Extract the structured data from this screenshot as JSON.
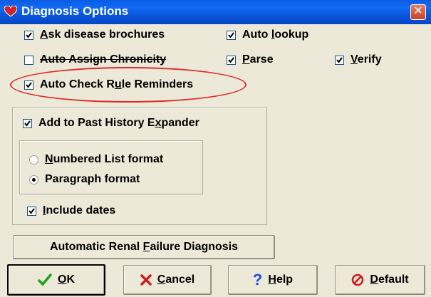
{
  "window": {
    "title": "Diagnosis Options",
    "close_glyph": "✕"
  },
  "options": {
    "ask_disease_brochures": {
      "label_key": "A",
      "label_rest": "sk disease brochures",
      "checked": true
    },
    "auto_lookup": {
      "label_pre": "Auto ",
      "label_key": "l",
      "label_rest": "ookup",
      "checked": true
    },
    "auto_assign_chronicity": {
      "label": "Auto Assign Chronicity",
      "checked": false
    },
    "parse": {
      "label_key": "P",
      "label_rest": "arse",
      "checked": true
    },
    "verify": {
      "label_key": "V",
      "label_rest": "erify",
      "checked": true
    },
    "auto_check_rule_reminders": {
      "label_pre": "Auto Check R",
      "label_key": "u",
      "label_rest": "le Reminders",
      "checked": true,
      "highlight_color": "#e12a2a"
    },
    "add_to_past_history": {
      "label_pre": "Add to Past History E",
      "label_key": "x",
      "label_rest": "pander",
      "checked": true
    },
    "numbered_list_format": {
      "label_key": "N",
      "label_rest": "umbered List format",
      "selected": false
    },
    "paragraph_format": {
      "label": "Paragraph format",
      "selected": true
    },
    "include_dates": {
      "label_key": "I",
      "label_rest": "nclude dates",
      "checked": true
    }
  },
  "buttons": {
    "renal": {
      "label_pre": "Automatic Renal ",
      "label_key": "F",
      "label_rest": "ailure Diagnosis"
    },
    "ok": {
      "label_key": "O",
      "label_rest": "K",
      "icon": "checkmark-icon",
      "color": "#1aa31a"
    },
    "cancel": {
      "label_key": "C",
      "label_rest": "ancel",
      "icon": "x-icon",
      "color": "#c81e1e"
    },
    "help": {
      "label_key": "H",
      "label_rest": "elp",
      "icon": "question-icon",
      "color": "#1d4fd8"
    },
    "default": {
      "label_key": "D",
      "label_rest": "efault",
      "icon": "no-icon",
      "color": "#d01818"
    }
  }
}
